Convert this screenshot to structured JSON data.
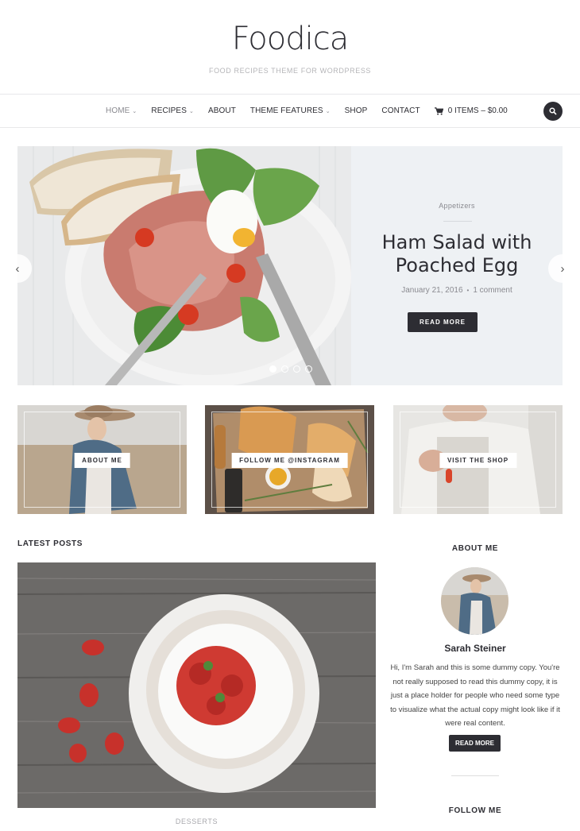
{
  "site": {
    "title": "Foodica",
    "tagline": "FOOD RECIPES THEME FOR WORDPRESS"
  },
  "nav": {
    "items": [
      {
        "label": "HOME",
        "dropdown": true,
        "active": true
      },
      {
        "label": "RECIPES",
        "dropdown": true
      },
      {
        "label": "ABOUT",
        "dropdown": false
      },
      {
        "label": "THEME FEATURES",
        "dropdown": true
      },
      {
        "label": "SHOP",
        "dropdown": false
      },
      {
        "label": "CONTACT",
        "dropdown": false
      }
    ],
    "cart_label": "0 ITEMS – $0.00",
    "chevron": "⌄",
    "search_icon": "search-icon"
  },
  "slider": {
    "category": "Appetizers",
    "title_line1": "Ham Salad with",
    "title_line2": "Poached Egg",
    "date": "January 21, 2016",
    "separator": "•",
    "comments": "1 comment",
    "button_label": "READ MORE",
    "prev_arrow": "‹",
    "next_arrow": "›",
    "slide_count": 4,
    "active_slide": 1
  },
  "promos": [
    {
      "label": "ABOUT ME"
    },
    {
      "label": "FOLLOW ME @INSTAGRAM"
    },
    {
      "label": "VISIT THE SHOP"
    }
  ],
  "latest_posts": {
    "heading": "LATEST POSTS",
    "first_post_category": "DESSERTS"
  },
  "sidebar": {
    "about_heading": "ABOUT ME",
    "author_name": "Sarah Steiner",
    "bio": "Hi, I'm Sarah and this is some dummy copy. You're not really supposed to read this dummy copy, it is just a place holder for people who need some type to visualize what the actual copy might look like if it were real content.",
    "button_label": "READ MORE",
    "follow_heading": "FOLLOW ME"
  },
  "colors": {
    "dark": "#2d2d33",
    "muted": "#8a8a90",
    "slider_bg": "#eef1f4"
  }
}
